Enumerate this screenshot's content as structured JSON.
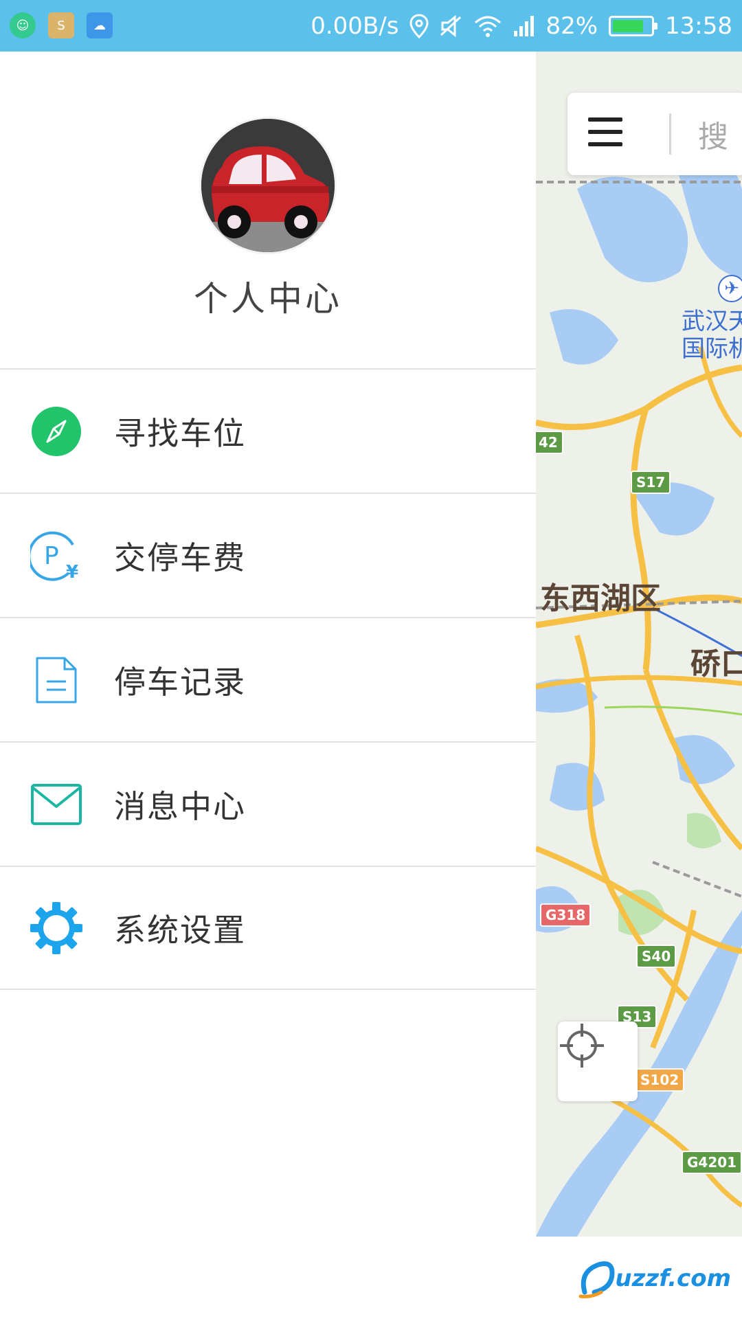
{
  "status_bar": {
    "network_speed": "0.00B/s",
    "battery_percent": "82%",
    "battery_level": 0.82,
    "time": "13:58",
    "notification_icons": [
      "chat-app-icon",
      "gallery-app-icon",
      "weather-icon"
    ],
    "status_icons": [
      "location-icon",
      "mute-icon",
      "wifi-icon",
      "signal-icon",
      "battery-icon"
    ],
    "bar_color": "#5bc0ea"
  },
  "drawer": {
    "profile_title": "个人中心",
    "avatar_icon": "red-toy-car-avatar",
    "items": [
      {
        "label": "寻找车位",
        "icon": "compass-icon",
        "color": "#21c46a"
      },
      {
        "label": "交停车费",
        "icon": "parking-fee-icon",
        "color": "#37a6e6"
      },
      {
        "label": "停车记录",
        "icon": "document-icon",
        "color": "#37a6e6"
      },
      {
        "label": "消息中心",
        "icon": "mail-icon",
        "color": "#18b6a3"
      },
      {
        "label": "系统设置",
        "icon": "gear-icon",
        "color": "#1ca4ec"
      }
    ]
  },
  "map": {
    "menu_icon": "hamburger-menu-icon",
    "search_placeholder": "搜",
    "labels": {
      "airport": "武汉天",
      "airport_2": "国际机",
      "district": "东西湖区",
      "district_2": "硚口"
    },
    "roads": [
      "42",
      "S17",
      "G318",
      "S40",
      "S13",
      "S102",
      "G4201"
    ],
    "locate_icon": "crosshair-locate-icon"
  },
  "watermark": {
    "text": "uzzf.com"
  }
}
